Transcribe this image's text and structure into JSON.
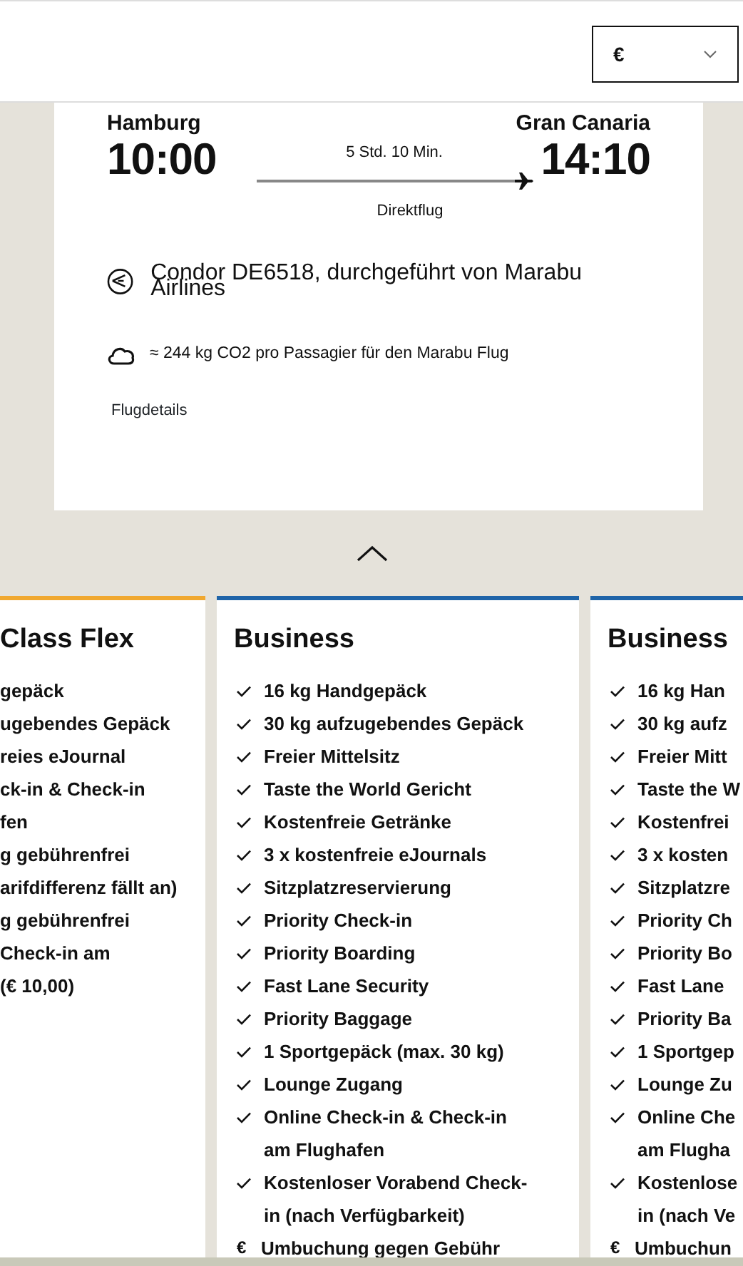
{
  "currency_select": {
    "value": "€"
  },
  "flight": {
    "origin": "Hamburg",
    "departure": "10:00",
    "duration": "5 Std. 10 Min.",
    "destination": "Gran Canaria",
    "arrival": "14:10",
    "stops": "Direktflug",
    "operator": "Condor DE6518, durchgeführt von Marabu Airlines",
    "emissions": "≈ 244 kg CO2 pro Passagier für den Marabu Flug",
    "details_link": "Flugdetails"
  },
  "fares": [
    {
      "title": "Class Flex",
      "color": "#f0a830",
      "items": [
        {
          "lines": [
            "gepäck"
          ]
        },
        {
          "lines": [
            "ugebendes Gepäck"
          ]
        },
        {
          "lines": [
            "reies eJournal"
          ]
        },
        {
          "lines": [
            "ck-in & Check-in",
            "fen"
          ]
        },
        {
          "lines": [
            "g gebührenfrei",
            "arifdifferenz fällt an)"
          ]
        },
        {
          "lines": [
            "g gebührenfrei"
          ]
        },
        {
          "lines": [
            "Check-in am",
            "(€ 10,00)"
          ]
        }
      ]
    },
    {
      "title": "Business",
      "color": "#1f64a8",
      "items": [
        {
          "kind": "check",
          "lines": [
            "16 kg Handgepäck"
          ]
        },
        {
          "kind": "check",
          "lines": [
            "30 kg aufzugebendes Gepäck"
          ]
        },
        {
          "kind": "check",
          "lines": [
            "Freier Mittelsitz"
          ]
        },
        {
          "kind": "check",
          "lines": [
            "Taste the World Gericht"
          ]
        },
        {
          "kind": "check",
          "lines": [
            "Kostenfreie Getränke"
          ]
        },
        {
          "kind": "check",
          "lines": [
            "3 x kostenfreie eJournals"
          ]
        },
        {
          "kind": "check",
          "lines": [
            "Sitzplatzreservierung"
          ]
        },
        {
          "kind": "check",
          "lines": [
            "Priority Check-in"
          ]
        },
        {
          "kind": "check",
          "lines": [
            "Priority Boarding"
          ]
        },
        {
          "kind": "check",
          "lines": [
            "Fast Lane Security"
          ]
        },
        {
          "kind": "check",
          "lines": [
            "Priority Baggage"
          ]
        },
        {
          "kind": "check",
          "lines": [
            "1 Sportgepäck (max. 30 kg)"
          ]
        },
        {
          "kind": "check",
          "lines": [
            "Lounge Zugang"
          ]
        },
        {
          "kind": "check",
          "lines": [
            "Online Check-in & Check-in",
            "am Flughafen"
          ]
        },
        {
          "kind": "check",
          "lines": [
            "Kostenloser Vorabend Check-",
            "in (nach Verfügbarkeit)"
          ]
        },
        {
          "kind": "fee",
          "symbol": "€",
          "lines": [
            "Umbuchung gegen Gebühr"
          ]
        }
      ]
    },
    {
      "title": "Business",
      "color": "#1f64a8",
      "items": [
        {
          "kind": "check",
          "lines": [
            "16 kg Han"
          ]
        },
        {
          "kind": "check",
          "lines": [
            "30 kg aufz"
          ]
        },
        {
          "kind": "check",
          "lines": [
            "Freier Mitt"
          ]
        },
        {
          "kind": "check",
          "lines": [
            "Taste the W"
          ]
        },
        {
          "kind": "check",
          "lines": [
            "Kostenfrei"
          ]
        },
        {
          "kind": "check",
          "lines": [
            "3 x kosten"
          ]
        },
        {
          "kind": "check",
          "lines": [
            "Sitzplatzre"
          ]
        },
        {
          "kind": "check",
          "lines": [
            "Priority Ch"
          ]
        },
        {
          "kind": "check",
          "lines": [
            "Priority Bo"
          ]
        },
        {
          "kind": "check",
          "lines": [
            "Fast Lane"
          ]
        },
        {
          "kind": "check",
          "lines": [
            "Priority Ba"
          ]
        },
        {
          "kind": "check",
          "lines": [
            "1 Sportgep"
          ]
        },
        {
          "kind": "check",
          "lines": [
            "Lounge Zu"
          ]
        },
        {
          "kind": "check",
          "lines": [
            "Online Che",
            "am Flugha"
          ]
        },
        {
          "kind": "check",
          "lines": [
            "Kostenlose",
            "in (nach Ve"
          ]
        },
        {
          "kind": "fee",
          "symbol": "€",
          "lines": [
            "Umbuchun"
          ]
        }
      ]
    }
  ]
}
